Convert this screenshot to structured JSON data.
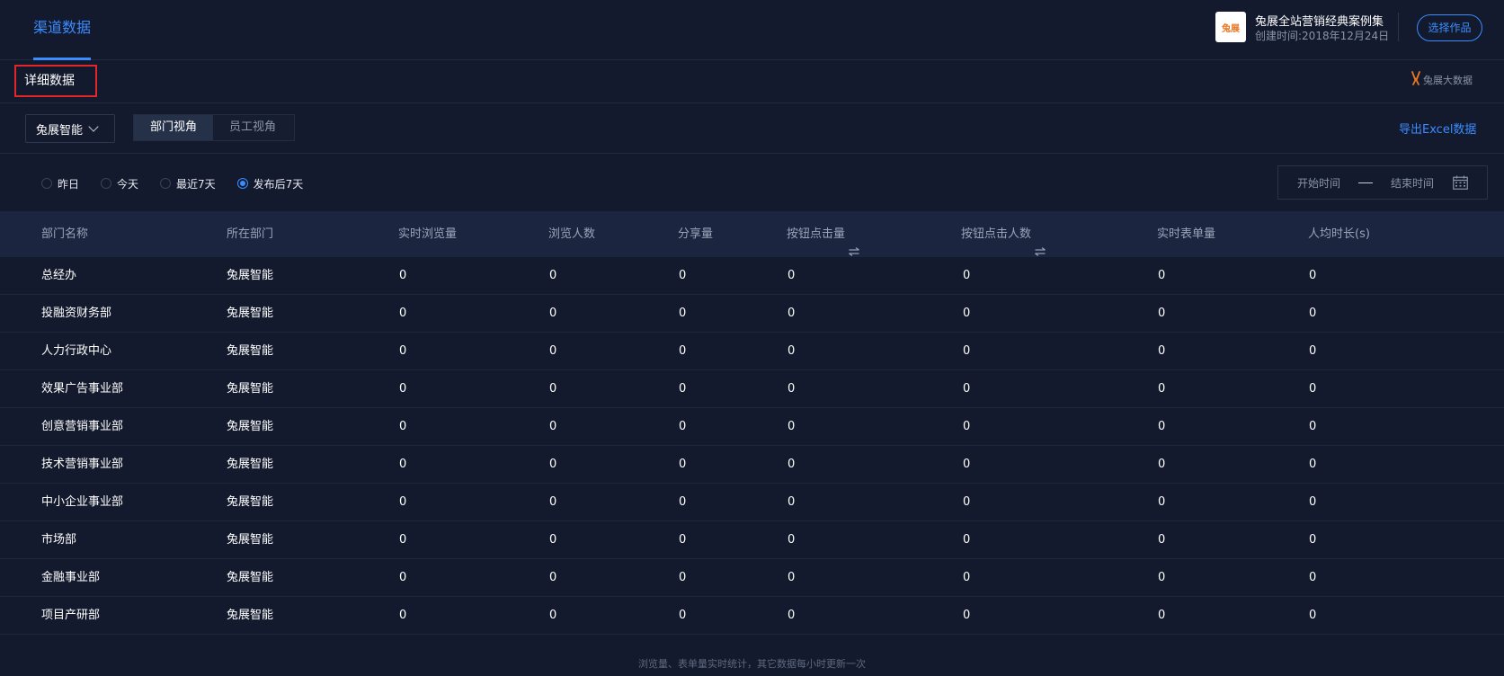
{
  "header": {
    "active_tab": "渠道数据",
    "work_title": "兔展全站营销经典案例集",
    "work_created": "创建时间:2018年12月24日",
    "select_work_button": "选择作品",
    "thumb_logo_text": "兔展"
  },
  "section": {
    "title": "详细数据",
    "brand_label": "兔展大数据"
  },
  "toolbar": {
    "company_select": "兔展智能",
    "views": [
      {
        "label": "部门视角",
        "active": true
      },
      {
        "label": "员工视角",
        "active": false
      }
    ],
    "export_label": "导出Excel数据"
  },
  "filters": {
    "ranges": [
      {
        "label": "昨日",
        "checked": false
      },
      {
        "label": "今天",
        "checked": false
      },
      {
        "label": "最近7天",
        "checked": false
      },
      {
        "label": "发布后7天",
        "checked": true
      }
    ],
    "start_placeholder": "开始时间",
    "end_placeholder": "结束时间"
  },
  "table": {
    "columns": [
      "部门名称",
      "所在部门",
      "实时浏览量",
      "浏览人数",
      "分享量",
      "按钮点击量",
      "按钮点击人数",
      "实时表单量",
      "人均时长(s)"
    ],
    "sortable_columns": [
      5,
      6
    ],
    "rows": [
      [
        "总经办",
        "兔展智能",
        "0",
        "0",
        "0",
        "0",
        "0",
        "0",
        "0"
      ],
      [
        "投融资财务部",
        "兔展智能",
        "0",
        "0",
        "0",
        "0",
        "0",
        "0",
        "0"
      ],
      [
        "人力行政中心",
        "兔展智能",
        "0",
        "0",
        "0",
        "0",
        "0",
        "0",
        "0"
      ],
      [
        "效果广告事业部",
        "兔展智能",
        "0",
        "0",
        "0",
        "0",
        "0",
        "0",
        "0"
      ],
      [
        "创意营销事业部",
        "兔展智能",
        "0",
        "0",
        "0",
        "0",
        "0",
        "0",
        "0"
      ],
      [
        "技术营销事业部",
        "兔展智能",
        "0",
        "0",
        "0",
        "0",
        "0",
        "0",
        "0"
      ],
      [
        "中小企业事业部",
        "兔展智能",
        "0",
        "0",
        "0",
        "0",
        "0",
        "0",
        "0"
      ],
      [
        "市场部",
        "兔展智能",
        "0",
        "0",
        "0",
        "0",
        "0",
        "0",
        "0"
      ],
      [
        "金融事业部",
        "兔展智能",
        "0",
        "0",
        "0",
        "0",
        "0",
        "0",
        "0"
      ],
      [
        "项目产研部",
        "兔展智能",
        "0",
        "0",
        "0",
        "0",
        "0",
        "0",
        "0"
      ]
    ]
  },
  "footnote": "浏览量、表单量实时统计，其它数据每小时更新一次",
  "colors": {
    "accent": "#3b8cff",
    "background": "#131a2d",
    "header_row": "#1b2540",
    "highlight_border": "#e3262a",
    "brand_orange": "#e87722"
  },
  "icons": {
    "select_chevron": "chevron-down-icon",
    "sort": "sort-icon",
    "calendar": "calendar-icon",
    "brand": "bunny-logo-icon"
  }
}
